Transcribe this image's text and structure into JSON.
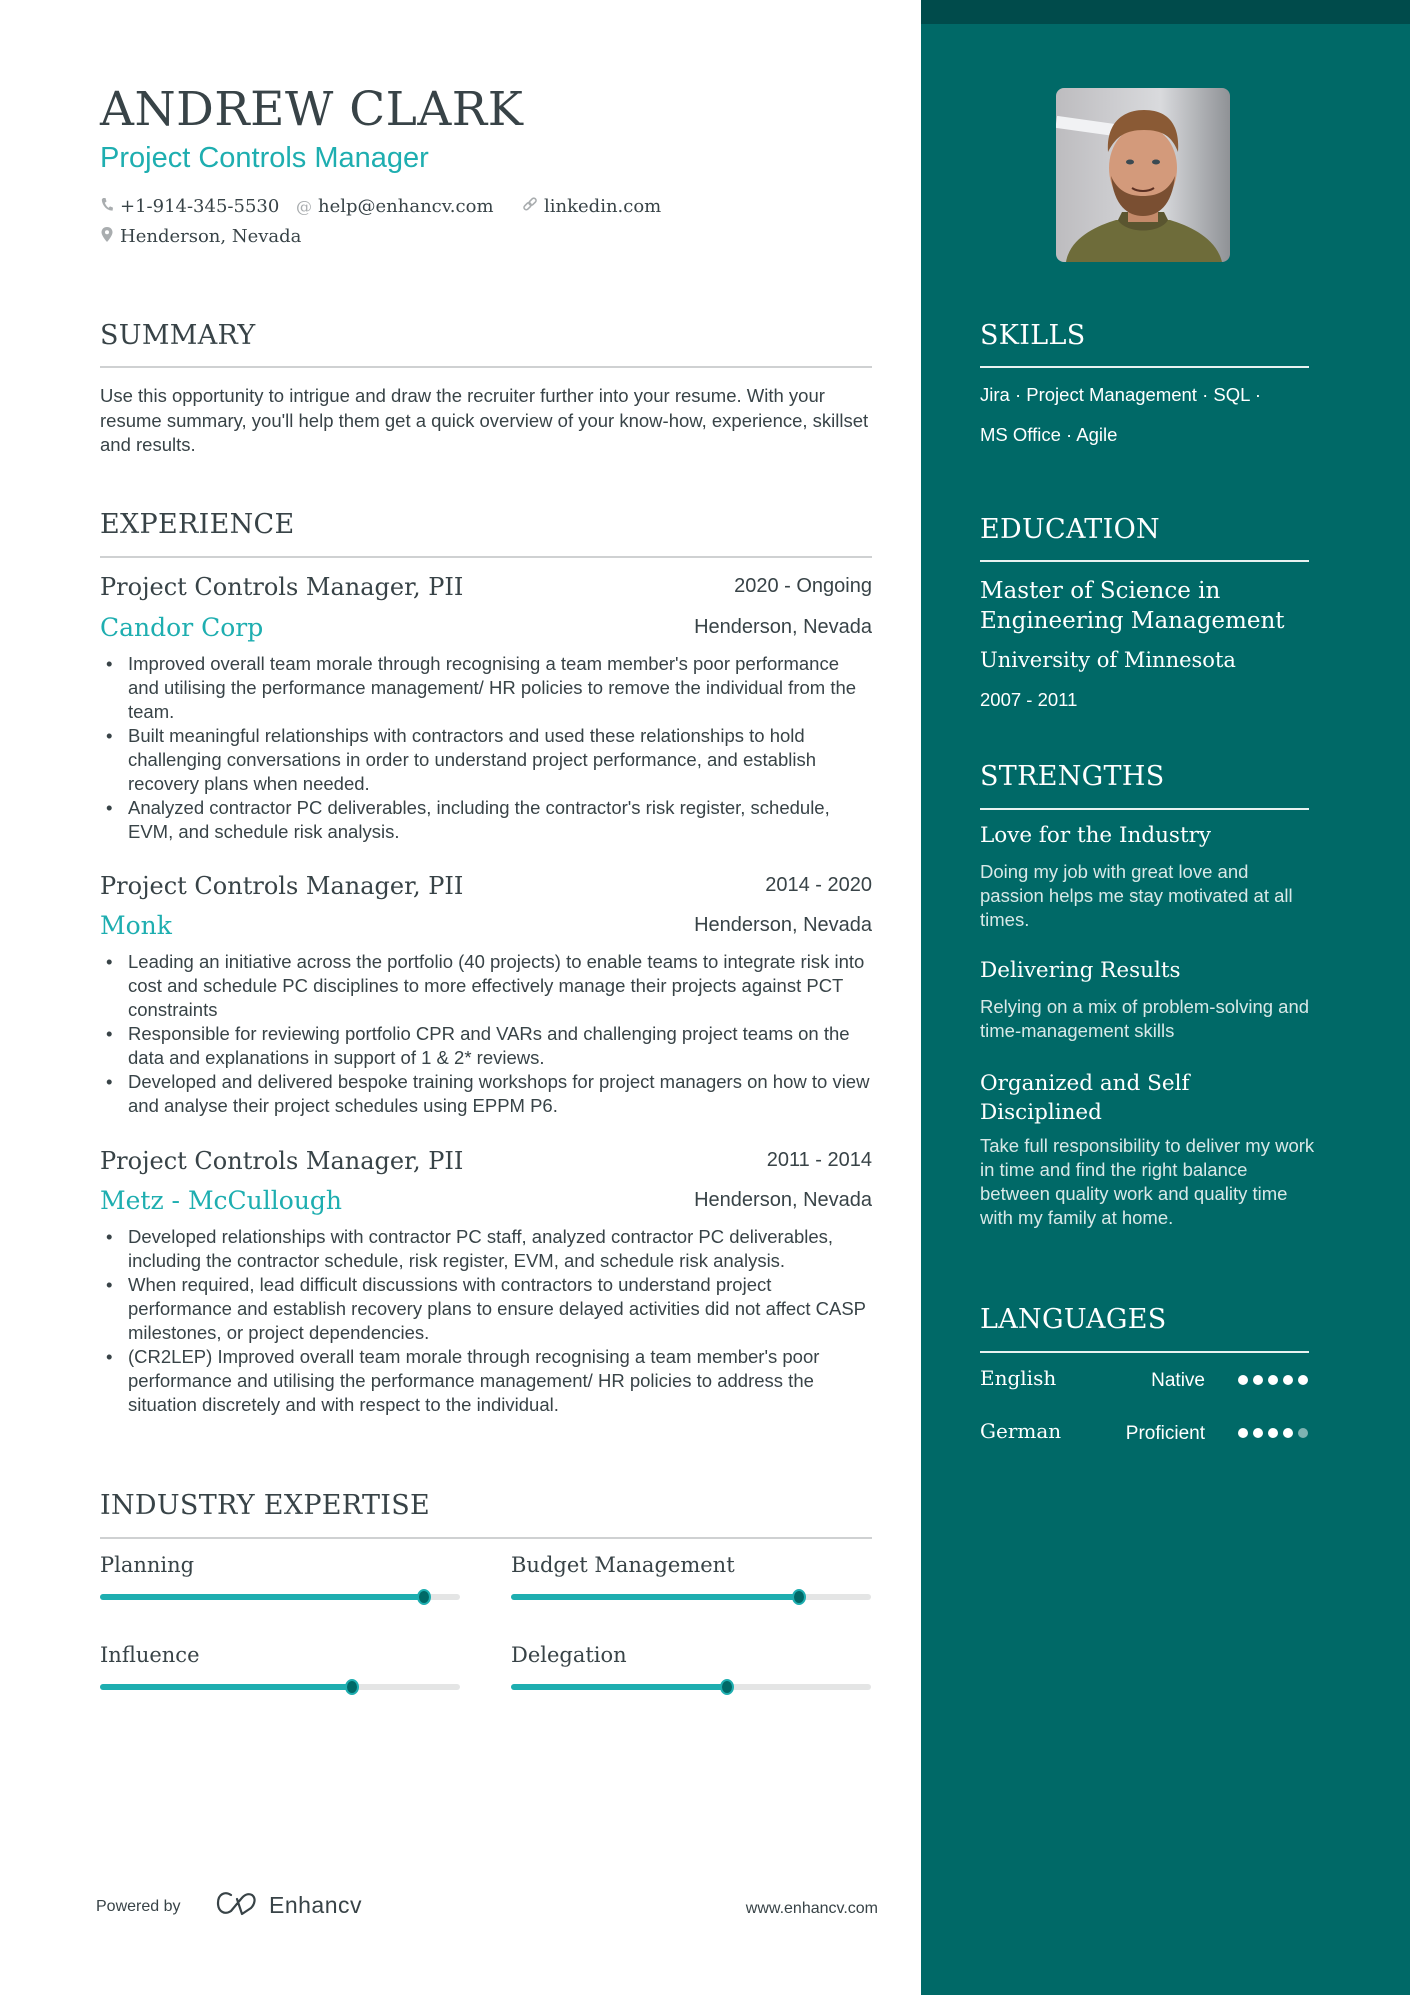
{
  "header": {
    "name": "ANDREW CLARK",
    "title": "Project Controls Manager",
    "contacts": {
      "phone": "+1-914-345-5530",
      "email": "help@enhancv.com",
      "link": "linkedin.com",
      "location": "Henderson, Nevada"
    },
    "icons": {
      "phone": "phone-icon",
      "email": "at-icon",
      "link": "link-icon",
      "location": "map-pin-icon"
    }
  },
  "summary": {
    "heading": "SUMMARY",
    "text": "Use this opportunity to intrigue and draw the recruiter further into your resume. With your resume summary, you'll help them get a quick overview of your know-how, experience, skillset and results."
  },
  "experience": {
    "heading": "EXPERIENCE",
    "jobs": [
      {
        "title": "Project Controls Manager, PII",
        "dates": "2020 - Ongoing",
        "company": "Candor Corp",
        "location": "Henderson, Nevada",
        "bullets": [
          "Improved overall team morale through recognising a team member's poor performance and utilising the performance management/ HR policies to remove the individual from the team.",
          "Built meaningful relationships with contractors and used these relationships to hold challenging conversations in order to understand project performance, and establish recovery plans when needed.",
          "Analyzed contractor PC deliverables, including the contractor's risk register, schedule, EVM, and schedule risk analysis."
        ]
      },
      {
        "title": "Project Controls Manager, PII",
        "dates": "2014 - 2020",
        "company": "Monk",
        "location": "Henderson, Nevada",
        "bullets": [
          "Leading an initiative across the portfolio (40 projects) to enable teams to integrate risk into cost and schedule PC disciplines to more effectively manage their projects against PCT constraints",
          "Responsible for reviewing portfolio CPR and VARs and challenging project teams on the data and explanations in support of 1 & 2* reviews.",
          "Developed and delivered bespoke training workshops for project managers on how to view and analyse their project schedules using EPPM P6."
        ]
      },
      {
        "title": "Project Controls Manager, PII",
        "dates": "2011 - 2014",
        "company": "Metz - McCullough",
        "location": "Henderson, Nevada",
        "bullets": [
          "Developed relationships with contractor PC staff, analyzed contractor PC deliverables, including the contractor schedule, risk register, EVM, and schedule risk analysis.",
          "When required, lead difficult discussions with contractors to understand project performance and establish recovery plans to ensure delayed activities did not affect CASP milestones, or project dependencies.",
          "(CR2LEP) Improved overall team morale through recognising a team member's poor performance and utilising the performance management/ HR policies to address the situation discretely and with respect to the individual."
        ]
      }
    ]
  },
  "expertise": {
    "heading": "INDUSTRY EXPERTISE",
    "items": [
      {
        "label": "Planning",
        "level": 0.9
      },
      {
        "label": "Budget Management",
        "level": 0.8
      },
      {
        "label": "Influence",
        "level": 0.7
      },
      {
        "label": "Delegation",
        "level": 0.6
      }
    ]
  },
  "footer": {
    "powered_by": "Powered by",
    "brand": "Enhancv",
    "website": "www.enhancv.com"
  },
  "sidebar": {
    "skills": {
      "heading": "SKILLS",
      "line1": "Jira · Project Management · SQL ·",
      "line2": "MS Office · Agile"
    },
    "education": {
      "heading": "EDUCATION",
      "degree_line1": "Master of Science in",
      "degree_line2": "Engineering Management",
      "school": "University of Minnesota",
      "dates": "2007 - 2011"
    },
    "strengths": {
      "heading": "STRENGTHS",
      "items": [
        {
          "title": "Love for the Industry",
          "desc": "Doing my job with great love and passion helps me stay motivated at all times."
        },
        {
          "title": "Delivering Results",
          "desc": "Relying on a mix of problem-solving and time-management skills"
        },
        {
          "title": "Organized and Self Disciplined",
          "desc": "Take full responsibility to deliver my work in time and find the right balance between quality work and quality time with my family at home."
        }
      ]
    },
    "languages": {
      "heading": "LANGUAGES",
      "items": [
        {
          "name": "English",
          "level": "Native",
          "rating": 5,
          "max": 5
        },
        {
          "name": "German",
          "level": "Proficient",
          "rating": 4,
          "max": 5
        }
      ]
    }
  },
  "colors": {
    "accent": "#1eaeb0",
    "sidebar": "#006967",
    "sidebar_band": "#004b4b",
    "text": "#384347"
  }
}
